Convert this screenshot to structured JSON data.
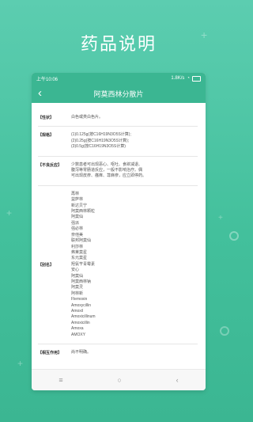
{
  "header": {
    "title": "药品说明"
  },
  "status": {
    "time": "上午10:06",
    "network": "1.8K/s",
    "battery": ""
  },
  "appbar": {
    "back_icon": "‹",
    "title": "阿莫西林分散片"
  },
  "rows": [
    {
      "label": "【性状】",
      "lines": [
        "白色或类白色片。"
      ]
    },
    {
      "label": "【规格】",
      "lines": [
        "(1)0.125g(按C16H19N3O5S计算);",
        "(2)0.25g(按C16H19N3O5S计算);",
        "(3)0.5g(按C16H19N3O5S计算)"
      ]
    },
    {
      "label": "【不良反应】",
      "lines": [
        "少数患者可出现恶心、呕吐、食欲减退、",
        "腹泻等胃肠道反应，一般不影响治疗。偶",
        "可出现皮疹、瘙痒、荨麻疹，应立即停药。"
      ]
    },
    {
      "label": "【别名】",
      "lines": [
        "再林",
        "益萨林",
        "新达贝宁",
        "阿莫西林颗粒",
        "阿莫仙",
        "强派",
        "强必林",
        "奈他美",
        "联邦阿莫仙",
        "利莎林",
        "弗莱莫星",
        "东元莫星",
        "羟氨苄青霉素",
        "安心",
        "阿莫仙",
        "阿莫西林钠",
        "阿莫灵",
        "阿林新",
        "Flemoxin",
        "Amoxycillin",
        "Amoxil",
        "Amoxicillinum",
        "Amoxicillin",
        "Amoxa",
        "AMOXY"
      ]
    },
    {
      "label": "【相互作用】",
      "lines": [
        "尚不明确。"
      ]
    }
  ],
  "navbar": {
    "menu": "≡",
    "home": "○",
    "back": "‹"
  }
}
